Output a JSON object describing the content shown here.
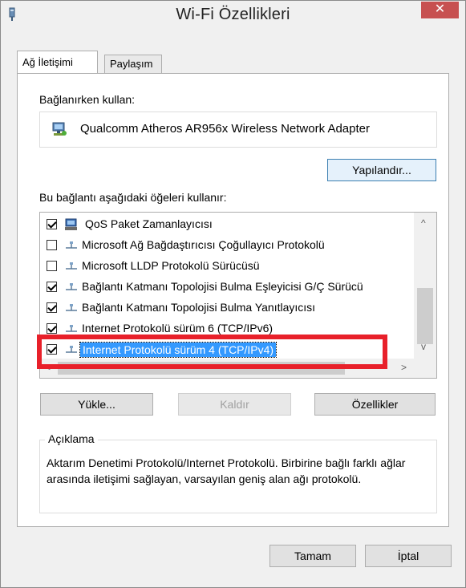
{
  "window": {
    "title": "Wi-Fi Özellikleri",
    "close_glyph": "✕"
  },
  "tabs": [
    {
      "label": "Ağ İletişimi",
      "active": true
    },
    {
      "label": "Paylaşım",
      "active": false
    }
  ],
  "connect_using": {
    "label": "Bağlanırken kullan:",
    "adapter_name": "Qualcomm Atheros AR956x Wireless Network Adapter",
    "adapter_icon": "network-adapter-icon"
  },
  "buttons": {
    "configure": "Yapılandır...",
    "install": "Yükle...",
    "uninstall": "Kaldır",
    "properties": "Özellikler",
    "ok": "Tamam",
    "cancel": "İptal"
  },
  "items_label": "Bu bağlantı aşağıdaki öğeleri kullanır:",
  "items": [
    {
      "label": "QoS Paket Zamanlayıcısı",
      "checked": true,
      "icon": "qos-icon",
      "selected": false
    },
    {
      "label": "Microsoft Ağ Bağdaştırıcısı Çoğullayıcı Protokolü",
      "checked": false,
      "icon": "protocol-icon",
      "selected": false
    },
    {
      "label": "Microsoft LLDP Protokolü Sürücüsü",
      "checked": false,
      "icon": "protocol-icon",
      "selected": false
    },
    {
      "label": "Bağlantı Katmanı Topolojisi Bulma Eşleyicisi G/Ç Sürücü",
      "checked": true,
      "icon": "protocol-icon",
      "selected": false
    },
    {
      "label": "Bağlantı Katmanı Topolojisi Bulma Yanıtlayıcısı",
      "checked": true,
      "icon": "protocol-icon",
      "selected": false
    },
    {
      "label": "Internet Protokolü sürüm 6 (TCP/IPv6)",
      "checked": true,
      "icon": "protocol-icon",
      "selected": false
    },
    {
      "label": "Internet Protokolü sürüm 4 (TCP/IPv4)",
      "checked": true,
      "icon": "protocol-icon",
      "selected": true
    }
  ],
  "scroll": {
    "up": "^",
    "down": "v",
    "left": "<",
    "right": ">"
  },
  "description": {
    "legend": "Açıklama",
    "text": "Aktarım Denetimi Protokolü/Internet Protokolü. Birbirine bağlı farklı ağlar arasında iletişimi sağlayan, varsayılan geniş alan ağı protokolü."
  },
  "colors": {
    "selection": "#3399ff",
    "highlight_box": "#e8202a",
    "close_button": "#c75050"
  }
}
